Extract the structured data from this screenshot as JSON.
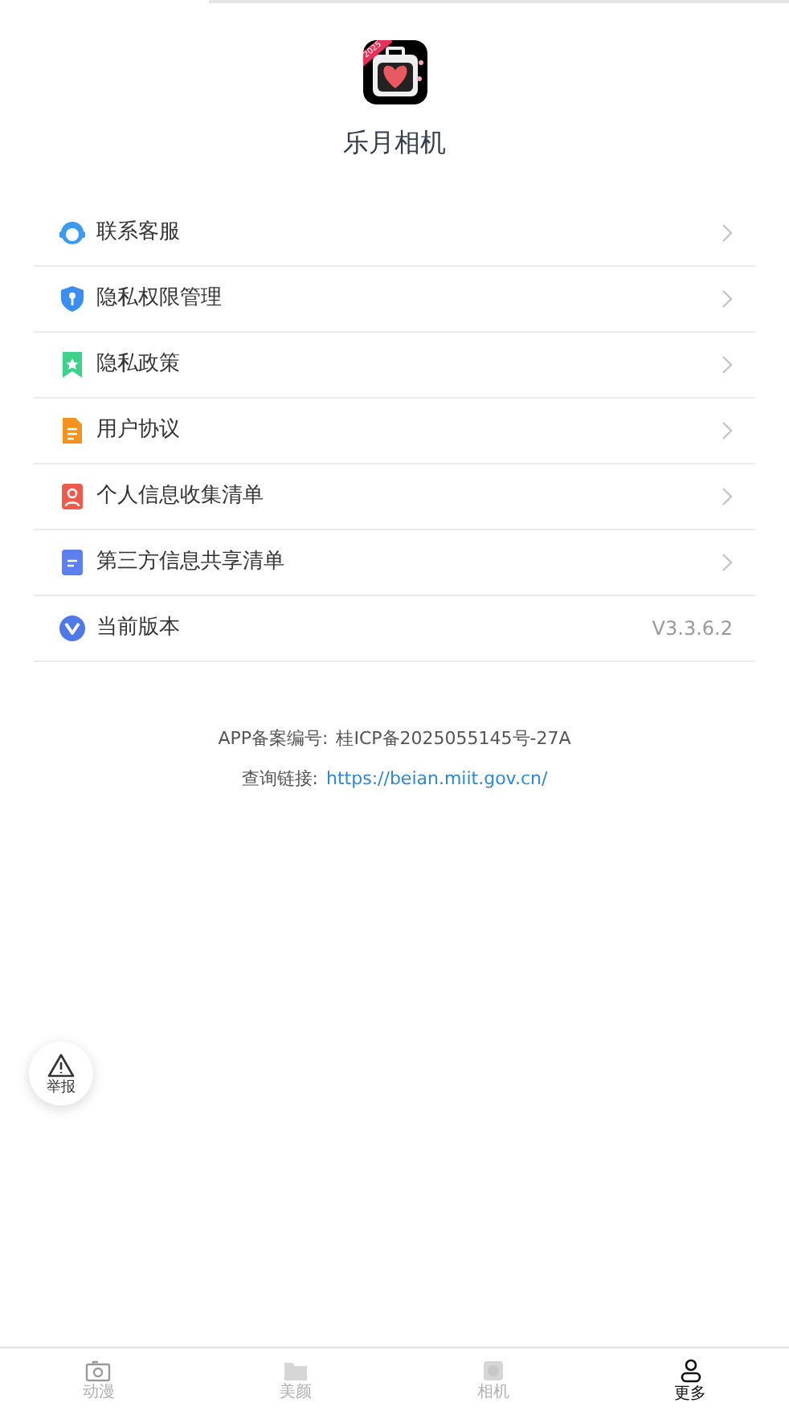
{
  "app": {
    "name": "乐月相机",
    "badge": "2025"
  },
  "menu": [
    {
      "kind": "link",
      "label": "联系客服"
    },
    {
      "kind": "link",
      "label": "隐私权限管理"
    },
    {
      "kind": "link",
      "label": "隐私政策"
    },
    {
      "kind": "link",
      "label": "用户协议"
    },
    {
      "kind": "link",
      "label": "个人信息收集清单"
    },
    {
      "kind": "link",
      "label": "第三方信息共享清单"
    },
    {
      "kind": "version",
      "label": "当前版本",
      "value": "V3.3.6.2"
    }
  ],
  "footer": {
    "record_label": "APP备案编号:",
    "record_number": "桂ICP备2025055145号-27A",
    "query_label": "查询链接:",
    "query_link": "https://beian.miit.gov.cn/"
  },
  "report_button": {
    "label": "举报"
  },
  "tabs": [
    {
      "label": "动漫",
      "selected": false
    },
    {
      "label": "美颜",
      "selected": false
    },
    {
      "label": "相机",
      "selected": false
    },
    {
      "label": "更多",
      "selected": true
    }
  ]
}
